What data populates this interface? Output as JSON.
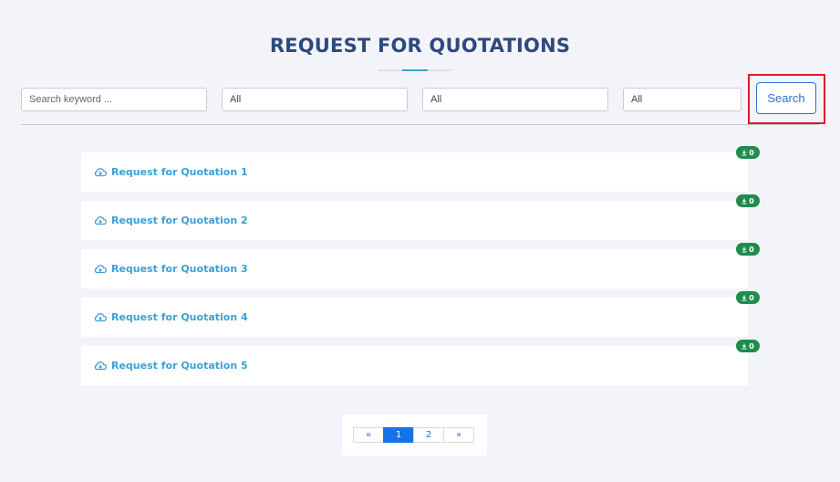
{
  "page": {
    "title": "REQUEST FOR QUOTATIONS"
  },
  "filters": {
    "keyword": {
      "placeholder": "Search keyword ...",
      "value": ""
    },
    "select_1": {
      "value": "All"
    },
    "select_2": {
      "value": "All"
    },
    "select_3": {
      "value": "All"
    },
    "search_label": "Search"
  },
  "quotations": [
    {
      "title": "Request for Quotation 1",
      "downloads": "0",
      "icon": "cloud-download-icon"
    },
    {
      "title": "Request for Quotation 2",
      "downloads": "0",
      "icon": "cloud-download-icon"
    },
    {
      "title": "Request for Quotation 3",
      "downloads": "0",
      "icon": "cloud-download-icon"
    },
    {
      "title": "Request for Quotation 4",
      "downloads": "0",
      "icon": "cloud-download-icon"
    },
    {
      "title": "Request for Quotation 5",
      "downloads": "0",
      "icon": "cloud-download-icon"
    }
  ],
  "pagination": {
    "prev": "«",
    "pages": [
      "1",
      "2"
    ],
    "current": "1",
    "next": "»"
  },
  "colors": {
    "title": "#2e4a7d",
    "link": "#3aa0d8",
    "badge": "#1e8c4e",
    "primary": "#1473e6",
    "highlight": "#e01b24"
  }
}
